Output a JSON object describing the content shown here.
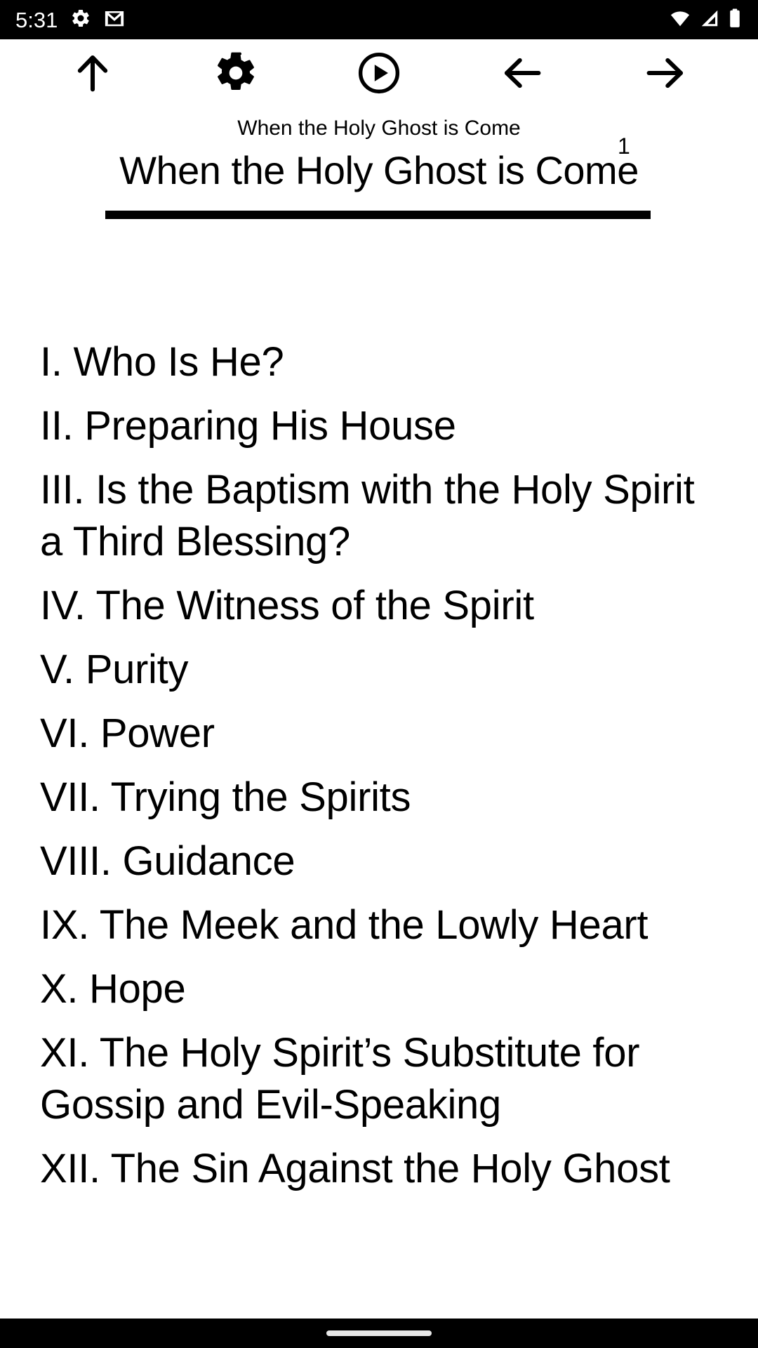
{
  "status_bar": {
    "time": "5:31",
    "left_icons": [
      {
        "name": "settings-gear-icon",
        "label": "gear-icon"
      },
      {
        "name": "gmail-icon",
        "label": "gmail-icon"
      }
    ],
    "right_icons": [
      {
        "name": "wifi-icon",
        "label": "wifi-full"
      },
      {
        "name": "cell-signal-icon",
        "label": "signal-partial"
      },
      {
        "name": "battery-icon",
        "label": "battery-full"
      }
    ],
    "background_color": "#000000",
    "foreground_color": "#ffffff"
  },
  "toolbar": {
    "buttons": [
      {
        "name": "scroll-up-button",
        "icon": "arrow-up-icon",
        "label": "Up"
      },
      {
        "name": "settings-button",
        "icon": "gear-icon",
        "label": "Settings"
      },
      {
        "name": "play-button",
        "icon": "play-circle-icon",
        "label": "Play"
      },
      {
        "name": "previous-page-button",
        "icon": "arrow-left-icon",
        "label": "Previous"
      },
      {
        "name": "next-page-button",
        "icon": "arrow-right-icon",
        "label": "Next"
      }
    ]
  },
  "document": {
    "running_header": "When the Holy Ghost is Come",
    "page_number": "1",
    "title": "When the Holy Ghost is Come",
    "contents": [
      "I. Who Is He?",
      "II. Preparing His House",
      "III. Is the Baptism with the Holy Spirit a Third Blessing?",
      "IV. The Witness of the Spirit",
      "V. Purity",
      "VI. Power",
      "VII. Trying the Spirits",
      "VIII. Guidance",
      "IX. The Meek and the Lowly Heart",
      "X. Hope",
      "XI. The Holy Spirit’s Substitute for Gossip and Evil-Speaking",
      "XII. The Sin Against the Holy Ghost"
    ]
  },
  "nav_bar": {
    "handle": "gesture-home-pill",
    "background_color": "#000000",
    "pill_color": "#e8e8e8"
  }
}
